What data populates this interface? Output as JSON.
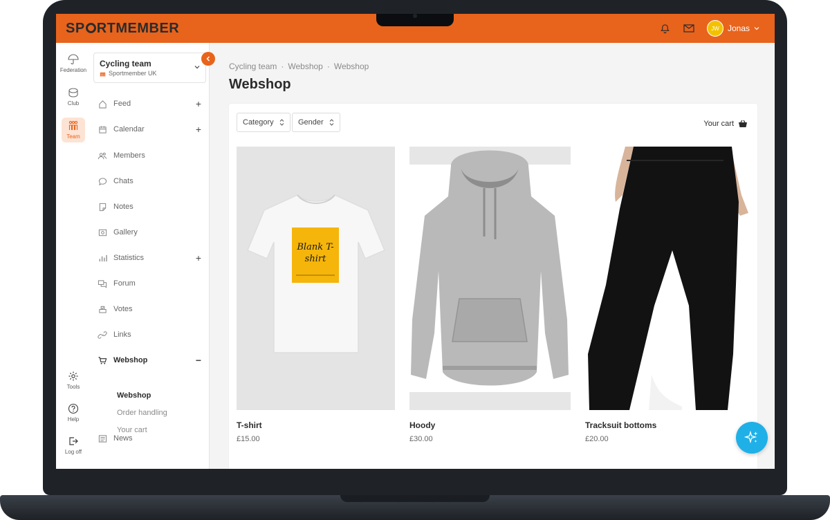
{
  "app": {
    "logo": "SP░RTMEMBER"
  },
  "header": {
    "user_initials": "JW",
    "user_name": "Jonas"
  },
  "rail": {
    "items": [
      "Federation",
      "Club",
      "Team",
      "Tools",
      "Help",
      "Log off"
    ]
  },
  "team": {
    "name": "Cycling team",
    "club": "Sportmember UK"
  },
  "nav": {
    "items": [
      "Feed",
      "Calendar",
      "Members",
      "Chats",
      "Notes",
      "Gallery",
      "Statistics",
      "Forum",
      "Votes",
      "Links",
      "Webshop",
      "News"
    ],
    "sub_items": [
      "Webshop",
      "Order handling",
      "Your cart"
    ]
  },
  "breadcrumb": [
    "Cycling team",
    "Webshop",
    "Webshop"
  ],
  "page": {
    "title": "Webshop"
  },
  "filters": {
    "category": "Category",
    "gender": "Gender"
  },
  "cart": {
    "label": "Your cart"
  },
  "products": [
    {
      "name": "T-shirt",
      "price": "£15.00",
      "print_text": "Blank T-shirt"
    },
    {
      "name": "Hoody",
      "price": "£30.00"
    },
    {
      "name": "Tracksuit bottoms",
      "price": "£20.00"
    }
  ],
  "colors": {
    "brand": "#e8631c",
    "fab": "#1fb0e8",
    "text": "#2b2b2b"
  }
}
